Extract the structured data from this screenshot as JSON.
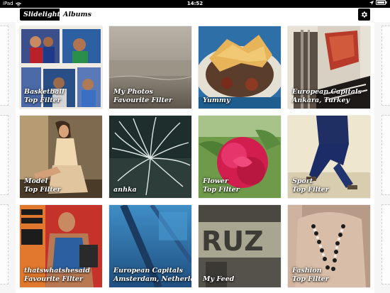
{
  "status_bar": {
    "carrier": "iPad",
    "time": "14:52"
  },
  "navbar": {
    "tabs": [
      {
        "label": "Slidelight",
        "active": true
      },
      {
        "label": "Albums",
        "active": false
      }
    ],
    "settings_icon": "gear-icon"
  },
  "albums": [
    {
      "line1": "Basketball",
      "line2": "Top Filter",
      "art": "basketball"
    },
    {
      "line1": "My Photos",
      "line2": "Favourite Filter",
      "art": "sea"
    },
    {
      "line1": "Yummy",
      "line2": "",
      "art": "food"
    },
    {
      "line1": "European Capitals",
      "line2": "Ankara, Turkey",
      "art": "ankara"
    },
    {
      "line1": "Model",
      "line2": "Top Filter",
      "art": "model"
    },
    {
      "line1": "anhka",
      "line2": "",
      "art": "anhka"
    },
    {
      "line1": "Flower",
      "line2": "Top Filter",
      "art": "flower"
    },
    {
      "line1": "Sport",
      "line2": "Top Filter",
      "art": "sport"
    },
    {
      "line1": "thatswhatshesaid",
      "line2": "Favourite Filter",
      "art": "poster"
    },
    {
      "line1": "European Capitals",
      "line2": "Amsterdam, Netherlands",
      "art": "amsterdam"
    },
    {
      "line1": "My Feed",
      "line2": "",
      "art": "ruz"
    },
    {
      "line1": "Fashion",
      "line2": "Top Filter",
      "art": "fashion"
    }
  ],
  "colors": {
    "status_bar_bg": "#000000",
    "tab_active_bg": "#000000",
    "caption_text": "#ffffff"
  }
}
